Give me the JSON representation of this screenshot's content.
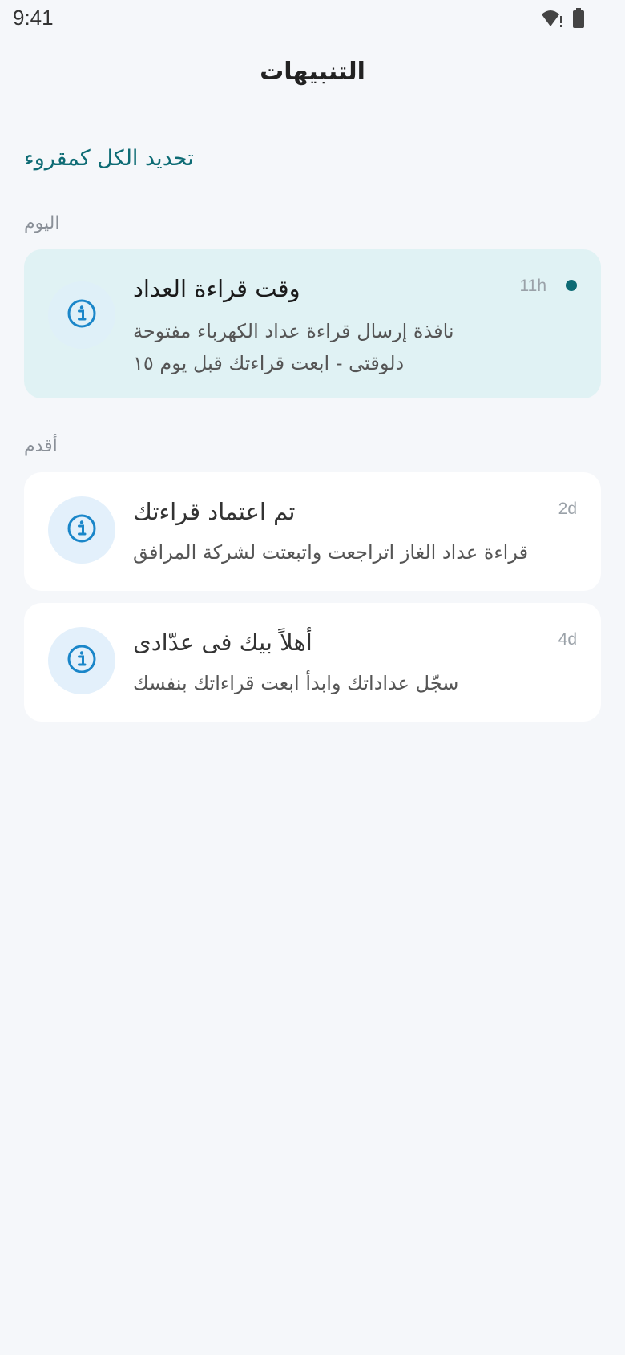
{
  "status_bar": {
    "time": "9:41",
    "wifi_icon": "wifi-alert-icon",
    "battery_icon": "battery-icon"
  },
  "header": {
    "title": "التنبيهات"
  },
  "actions": {
    "mark_all_read": "تحديد الكل كمقروء"
  },
  "sections": {
    "today": "اليوم",
    "older": "أقدم"
  },
  "notifications": [
    {
      "title": "وقت قراءة العداد",
      "body_line1": "نافذة إرسال قراءة عداد الكهرباء مفتوحة",
      "body_line2": "دلوقتى - ابعت قراءتك قبل يوم ١٥",
      "time": "11h",
      "unread": true,
      "icon": "info-icon"
    },
    {
      "title": "تم اعتماد قراءتك",
      "body_line1": "قراءة عداد الغاز اتراجعت واتبعتت لشركة المرافق",
      "time": "2d",
      "unread": false,
      "icon": "info-icon"
    },
    {
      "title": "أهلاً بيك فى عدّادى",
      "body_line1": "سجّل عداداتك وابدأ ابعت قراءاتك بنفسك",
      "time": "4d",
      "unread": false,
      "icon": "info-icon"
    }
  ],
  "colors": {
    "accent": "#0d6b74",
    "icon_blue": "#1a86c9",
    "unread_card_bg": "#e0f2f4",
    "page_bg": "#f5f7fa"
  }
}
